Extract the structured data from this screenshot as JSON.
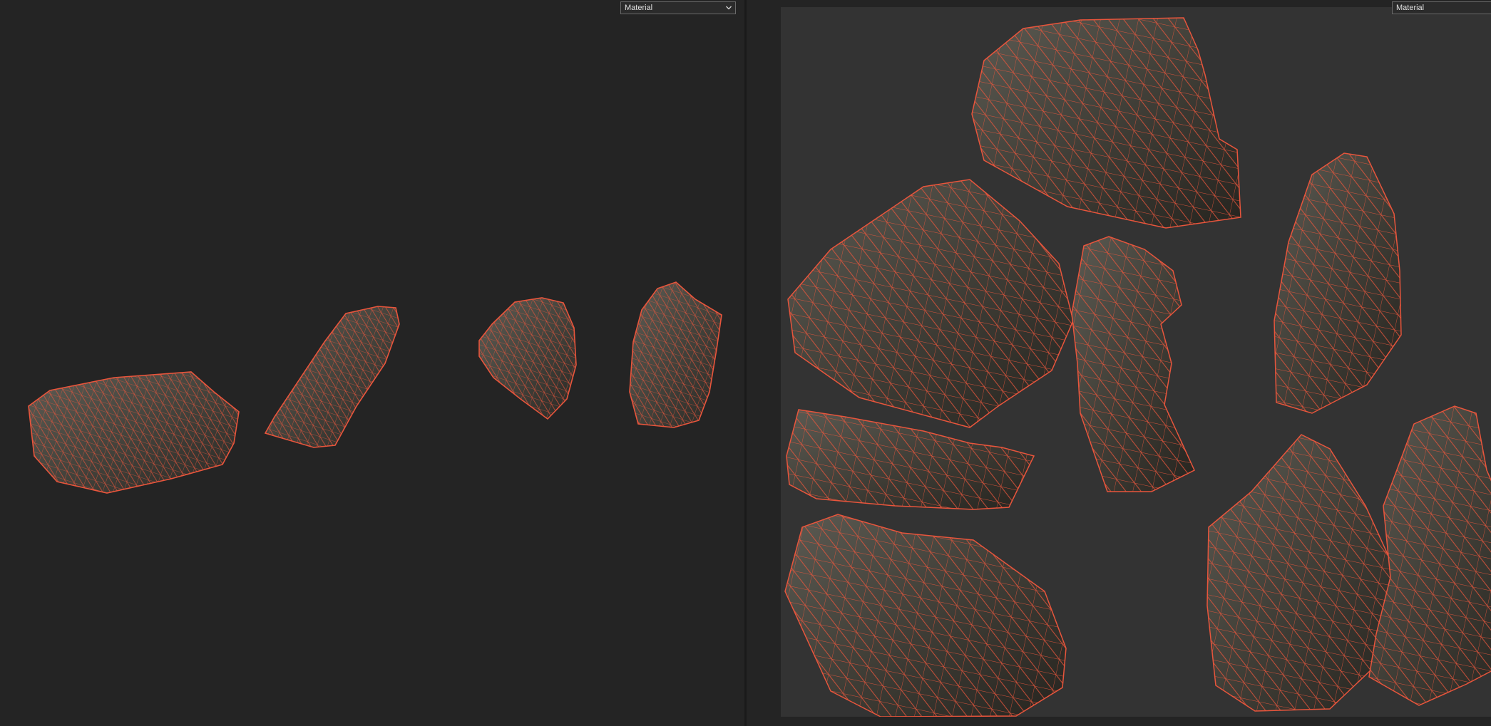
{
  "viewport_3d": {
    "shading_mode": "Material"
  },
  "viewport_uv": {
    "shading_mode": "Material"
  },
  "colors": {
    "background": "#242424",
    "uv_background": "#333333",
    "wireframe": "#e8553c",
    "rock_dark": "#2c2a25",
    "rock_light": "#5b5a52"
  },
  "icons": {
    "dropdown": "chevron-down-icon"
  }
}
